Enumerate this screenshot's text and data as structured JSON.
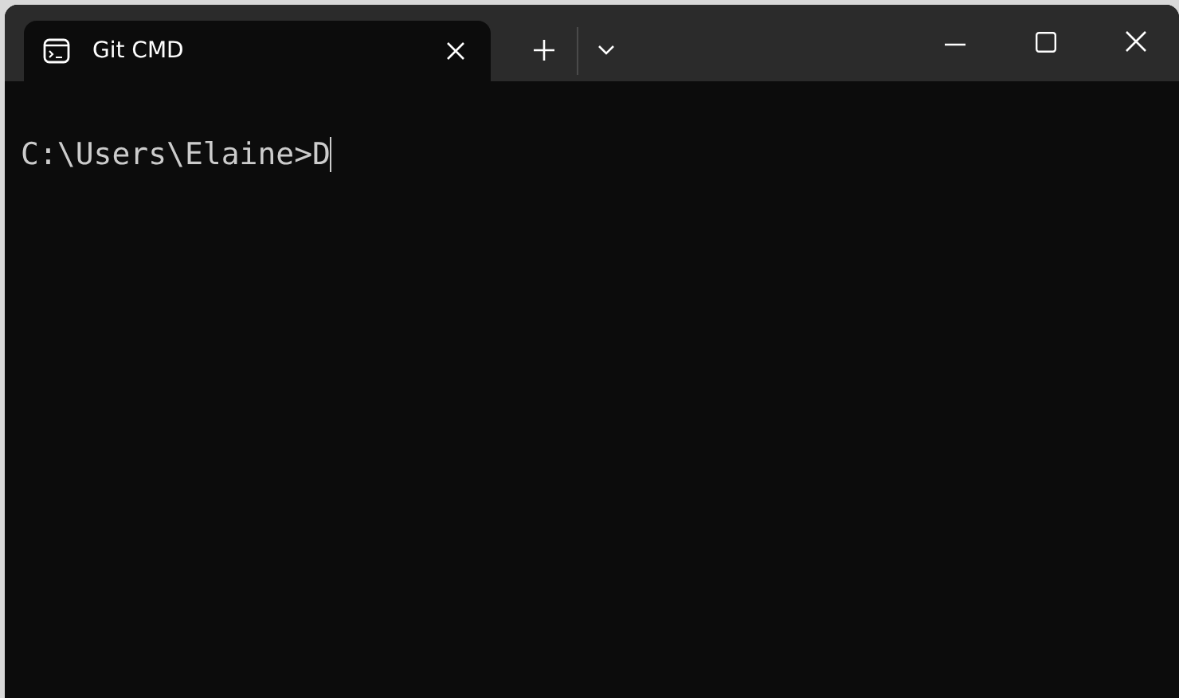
{
  "tabs": [
    {
      "title": "Git CMD",
      "selected": true
    }
  ],
  "terminal": {
    "lines": [
      "C:\\Users\\Elaine>D"
    ]
  }
}
